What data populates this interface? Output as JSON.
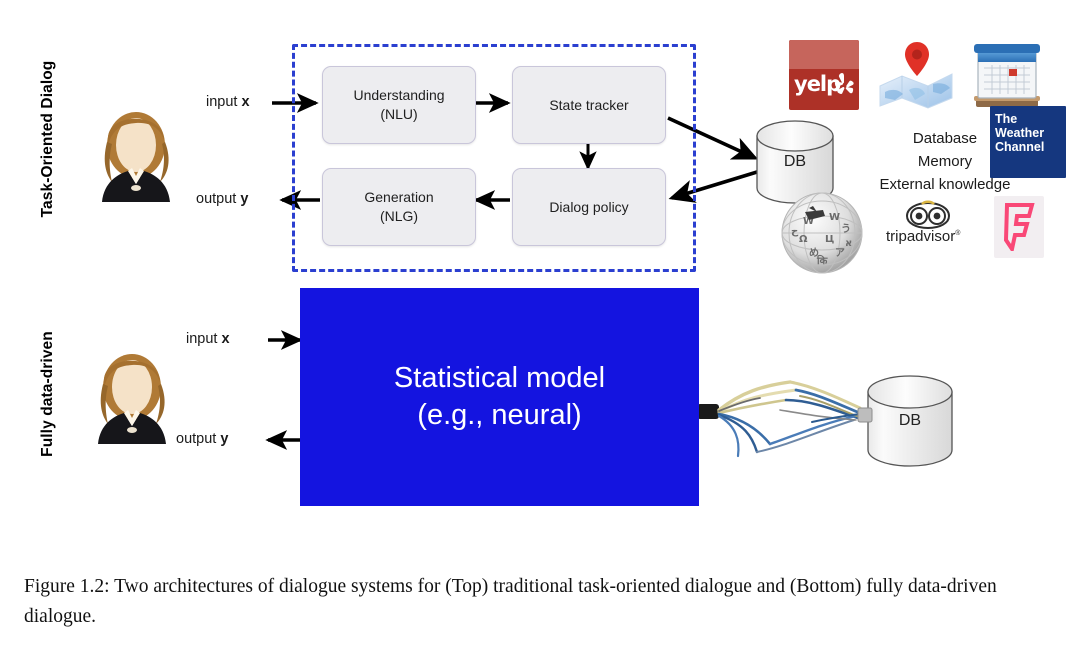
{
  "figure": {
    "caption": "Figure 1.2: Two architectures of dialogue systems for (Top) traditional task-oriented dialogue and (Bottom) fully data-driven dialogue."
  },
  "colors": {
    "dashed_border": "#2b3fd0",
    "statistical_model_bg": "#1414e0",
    "pipeline_box_bg": "#ededf0",
    "pipeline_box_border": "#c9c6da",
    "yelp_red": "#ad3127",
    "weather_channel_blue": "#15377f",
    "foursquare_pink": "#f94877",
    "map_pin_red": "#e03127"
  },
  "top_section": {
    "row_label": "Task-Oriented Dialog",
    "user_avatar": "woman-avatar-icon",
    "input_label_prefix": "input ",
    "input_label_var": "x",
    "output_label_prefix": "output ",
    "output_label_var": "y",
    "boxes": [
      {
        "id": "nlu",
        "line1": "Understanding",
        "line2": "(NLU)"
      },
      {
        "id": "state-tracker",
        "line1": "State tracker",
        "line2": ""
      },
      {
        "id": "dialog-policy",
        "line1": "Dialog policy",
        "line2": ""
      },
      {
        "id": "nlg",
        "line1": "Generation",
        "line2": "(NLG)"
      }
    ],
    "database": {
      "label": "DB"
    },
    "knowledge_lines": [
      "Database",
      "Memory",
      "External knowledge"
    ],
    "logos": [
      {
        "id": "yelp",
        "name": "yelp-logo",
        "text": "yelp"
      },
      {
        "id": "maps",
        "name": "map-logo",
        "text": ""
      },
      {
        "id": "calendar",
        "name": "calendar-logo",
        "text": ""
      },
      {
        "id": "weather-channel",
        "name": "weather-channel-logo",
        "line1": "The",
        "line2": "Weather",
        "line3": "Channel"
      },
      {
        "id": "wikipedia",
        "name": "wikipedia-globe-logo",
        "text": ""
      },
      {
        "id": "tripadvisor",
        "name": "tripadvisor-logo",
        "text": "tripadvisor",
        "mark": "®"
      },
      {
        "id": "foursquare",
        "name": "foursquare-logo",
        "text": "F"
      }
    ]
  },
  "bottom_section": {
    "row_label": "Fully data-driven",
    "user_avatar": "woman-avatar-icon",
    "input_label_prefix": "input ",
    "input_label_var": "x",
    "output_label_prefix": "output ",
    "output_label_var": "y",
    "model_line1": "Statistical model",
    "model_line2": "(e.g., neural)",
    "database": {
      "label": "DB"
    },
    "cable": "frayed-cable-icon"
  }
}
